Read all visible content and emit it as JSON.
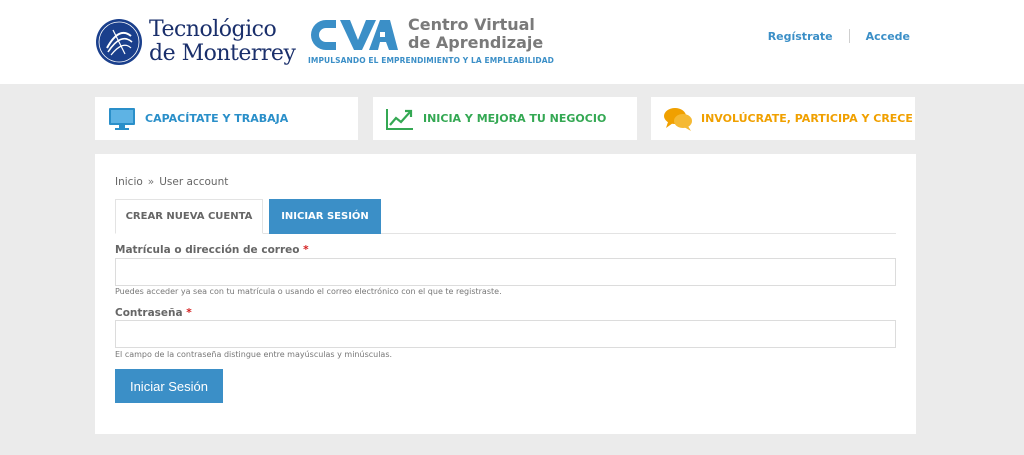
{
  "header": {
    "tec_line1": "Tecnológico",
    "tec_line2": "de Monterrey",
    "cva_title_line1": "Centro Virtual",
    "cva_title_line2": "de Aprendizaje",
    "cva_tagline": "IMPULSANDO EL EMPRENDIMIENTO Y LA EMPLEABILIDAD",
    "register_link": "Regístrate",
    "login_link": "Accede"
  },
  "categories": [
    {
      "label": "CAPACÍTATE Y TRABAJA",
      "icon": "monitor-icon",
      "color": "#2a8fc9"
    },
    {
      "label": "INICIA Y MEJORA TU NEGOCIO",
      "icon": "trend-chart-icon",
      "color": "#34a853"
    },
    {
      "label": "INVOLÚCRATE, PARTICIPA Y CRECE",
      "icon": "chat-bubbles-icon",
      "color": "#f0a000"
    }
  ],
  "breadcrumb": {
    "home": "Inicio",
    "separator": "»",
    "current": "User account"
  },
  "tabs": {
    "create": "CREAR NUEVA CUENTA",
    "login": "INICIAR SESIÓN"
  },
  "form": {
    "user_label": "Matrícula o dirección de correo",
    "user_required": "*",
    "user_value": "",
    "user_help": "Puedes acceder ya sea con tu matrícula o usando el correo electrónico con el que te registraste.",
    "password_label": "Contraseña",
    "password_required": "*",
    "password_value": "",
    "password_help": "El campo de la contraseña distingue entre mayúsculas y minúsculas.",
    "submit_label": "Iniciar Sesión"
  }
}
